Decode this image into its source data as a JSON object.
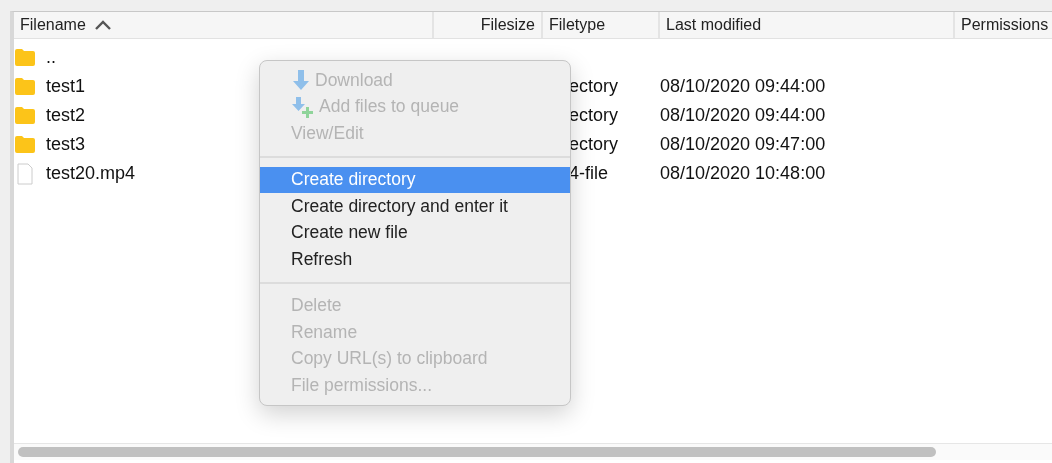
{
  "table": {
    "columns": [
      {
        "label": "Filename",
        "sorted": true
      },
      {
        "label": "Filesize"
      },
      {
        "label": "Filetype"
      },
      {
        "label": "Last modified"
      },
      {
        "label": "Permissions"
      }
    ],
    "rows": [
      {
        "kind": "folder",
        "name": "..",
        "filetype": "",
        "modified": ""
      },
      {
        "kind": "folder",
        "name": "test1",
        "filetype": "ectory",
        "modified": "08/10/2020 09:44:00"
      },
      {
        "kind": "folder",
        "name": "test2",
        "filetype": "ectory",
        "modified": "08/10/2020 09:44:00"
      },
      {
        "kind": "folder",
        "name": "test3",
        "filetype": "ectory",
        "modified": "08/10/2020 09:47:00"
      },
      {
        "kind": "file",
        "name": "test20.mp4",
        "filetype": "4-file",
        "modified": "08/10/2020 10:48:00"
      }
    ]
  },
  "context_menu": {
    "sections": [
      {
        "items": [
          {
            "label": "Download",
            "kind": "download",
            "disabled": true,
            "selected": false
          },
          {
            "label": "Add files to queue",
            "kind": "queue",
            "disabled": true,
            "selected": false
          },
          {
            "label": "View/Edit",
            "kind": "plain",
            "disabled": true,
            "selected": false
          }
        ]
      },
      {
        "items": [
          {
            "label": "Create directory",
            "kind": "plain",
            "disabled": false,
            "selected": true
          },
          {
            "label": "Create directory and enter it",
            "kind": "plain",
            "disabled": false,
            "selected": false
          },
          {
            "label": "Create new file",
            "kind": "plain",
            "disabled": false,
            "selected": false
          },
          {
            "label": "Refresh",
            "kind": "plain",
            "disabled": false,
            "selected": false
          }
        ]
      },
      {
        "items": [
          {
            "label": "Delete",
            "kind": "plain",
            "disabled": true,
            "selected": false
          },
          {
            "label": "Rename",
            "kind": "plain",
            "disabled": true,
            "selected": false
          },
          {
            "label": "Copy URL(s) to clipboard",
            "kind": "plain",
            "disabled": true,
            "selected": false
          },
          {
            "label": "File permissions...",
            "kind": "plain",
            "disabled": true,
            "selected": false
          }
        ]
      }
    ]
  }
}
